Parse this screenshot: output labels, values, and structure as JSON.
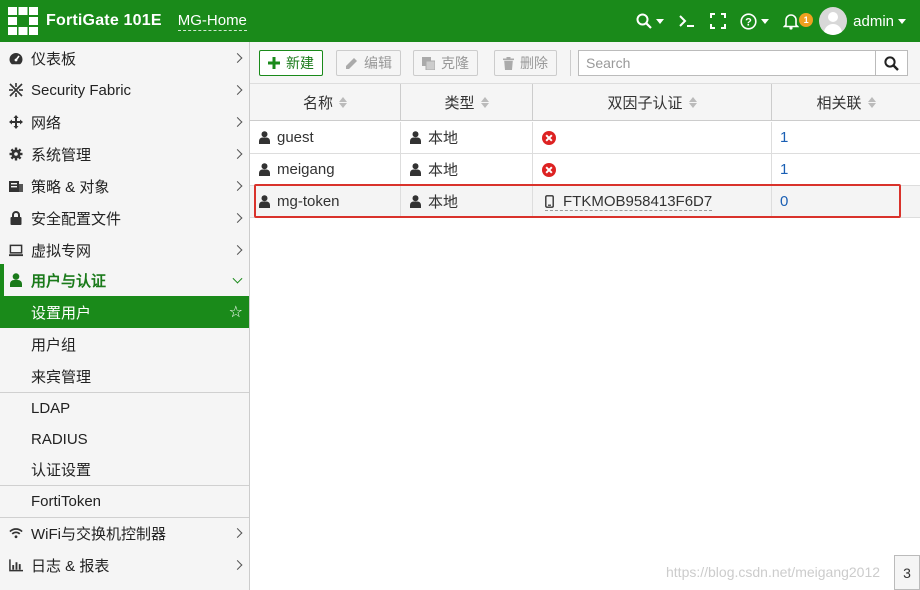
{
  "header": {
    "product": "FortiGate 101E",
    "hostname": "MG-Home",
    "user": "admin",
    "notification_count": "1",
    "icons": [
      "search-icon",
      "cli-icon",
      "fullscreen-icon",
      "help-icon",
      "bell-icon",
      "avatar"
    ]
  },
  "sidebar": {
    "items": [
      {
        "label": "仪表板",
        "icon": "dashboard-icon"
      },
      {
        "label": "Security Fabric",
        "icon": "fabric-icon"
      },
      {
        "label": "网络",
        "icon": "network-icon"
      },
      {
        "label": "系统管理",
        "icon": "gear-icon"
      },
      {
        "label": "策略 & 对象",
        "icon": "policy-icon"
      },
      {
        "label": "安全配置文件",
        "icon": "lock-icon"
      },
      {
        "label": "虚拟专网",
        "icon": "monitor-icon"
      }
    ],
    "group": {
      "label": "用户与认证",
      "icon": "user-icon"
    },
    "sub_items": [
      {
        "label": "设置用户"
      },
      {
        "label": "用户组"
      },
      {
        "label": "来宾管理"
      },
      {
        "label": "LDAP"
      },
      {
        "label": "RADIUS"
      },
      {
        "label": "认证设置"
      },
      {
        "label": "FortiToken"
      }
    ],
    "bottom_items": [
      {
        "label": "WiFi与交换机控制器",
        "icon": "wifi-icon"
      },
      {
        "label": "日志 & 报表",
        "icon": "chart-icon"
      }
    ]
  },
  "toolbar": {
    "new_label": "新建",
    "edit_label": "编辑",
    "clone_label": "克隆",
    "delete_label": "删除",
    "search_placeholder": "Search"
  },
  "table": {
    "columns": [
      "名称",
      "类型",
      "双因子认证",
      "相关联"
    ],
    "rows": [
      {
        "name": "guest",
        "type": "本地",
        "two_factor": "",
        "two_factor_state": "disabled",
        "ref": "1"
      },
      {
        "name": "meigang",
        "type": "本地",
        "two_factor": "",
        "two_factor_state": "disabled",
        "ref": "1"
      },
      {
        "name": "mg-token",
        "type": "本地",
        "two_factor": "FTKMOB958413F6D7",
        "two_factor_state": "token",
        "ref": "0"
      }
    ]
  },
  "footer": {
    "page_count": "3",
    "watermark": "https://blog.csdn.net/meigang2012"
  },
  "colors": {
    "brand_green": "#1a8a1a",
    "link_blue": "#1a5fb4",
    "highlight_red": "#d9322b",
    "error_red": "#dd2222",
    "badge_orange": "#f0a020"
  }
}
